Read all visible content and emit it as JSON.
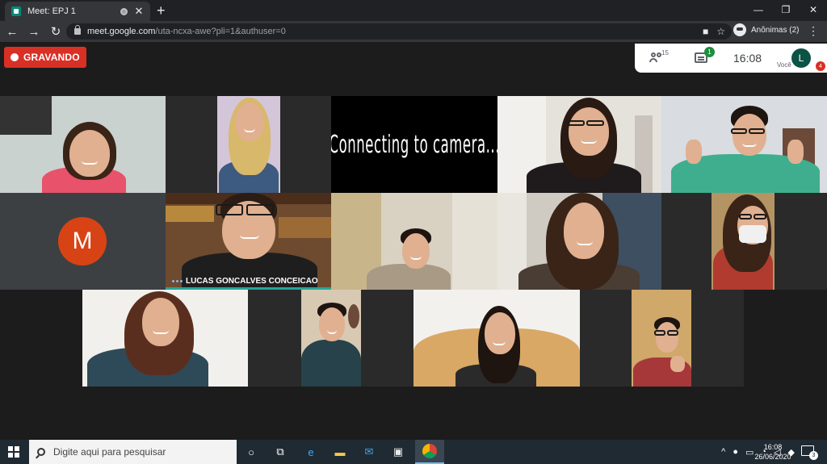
{
  "browser": {
    "tab_title": "Meet: EPJ 1",
    "tab_close": "✕",
    "new_tab": "+",
    "url_host": "meet.google.com",
    "url_path": "/uta-ncxa-awe?pli=1&authuser=0",
    "profile_label": "Anônimas (2)",
    "nav_back": "←",
    "nav_forward": "→",
    "nav_reload": "↻",
    "win_min": "—",
    "win_max": "❐",
    "win_close": "✕",
    "menu": "⋮",
    "icons": [
      "camera-icon",
      "star-icon"
    ]
  },
  "meet": {
    "recording_label": "GRAVANDO",
    "people_count": "15",
    "chat_count": "1",
    "time": "16:08",
    "you_label": "Você",
    "you_initial": "L",
    "hand_badge": "4",
    "connecting_text": "Connecting to camera...",
    "avatar_initial": "M",
    "speaker_name": "LUCAS GONCALVES CONCEICAO",
    "accent_color": "#d93025"
  },
  "taskbar": {
    "search_placeholder": "Digite aqui para pesquisar",
    "clock_time": "16:08",
    "clock_date": "26/06/2020",
    "notification_count": "3",
    "tray_caret": "^"
  }
}
